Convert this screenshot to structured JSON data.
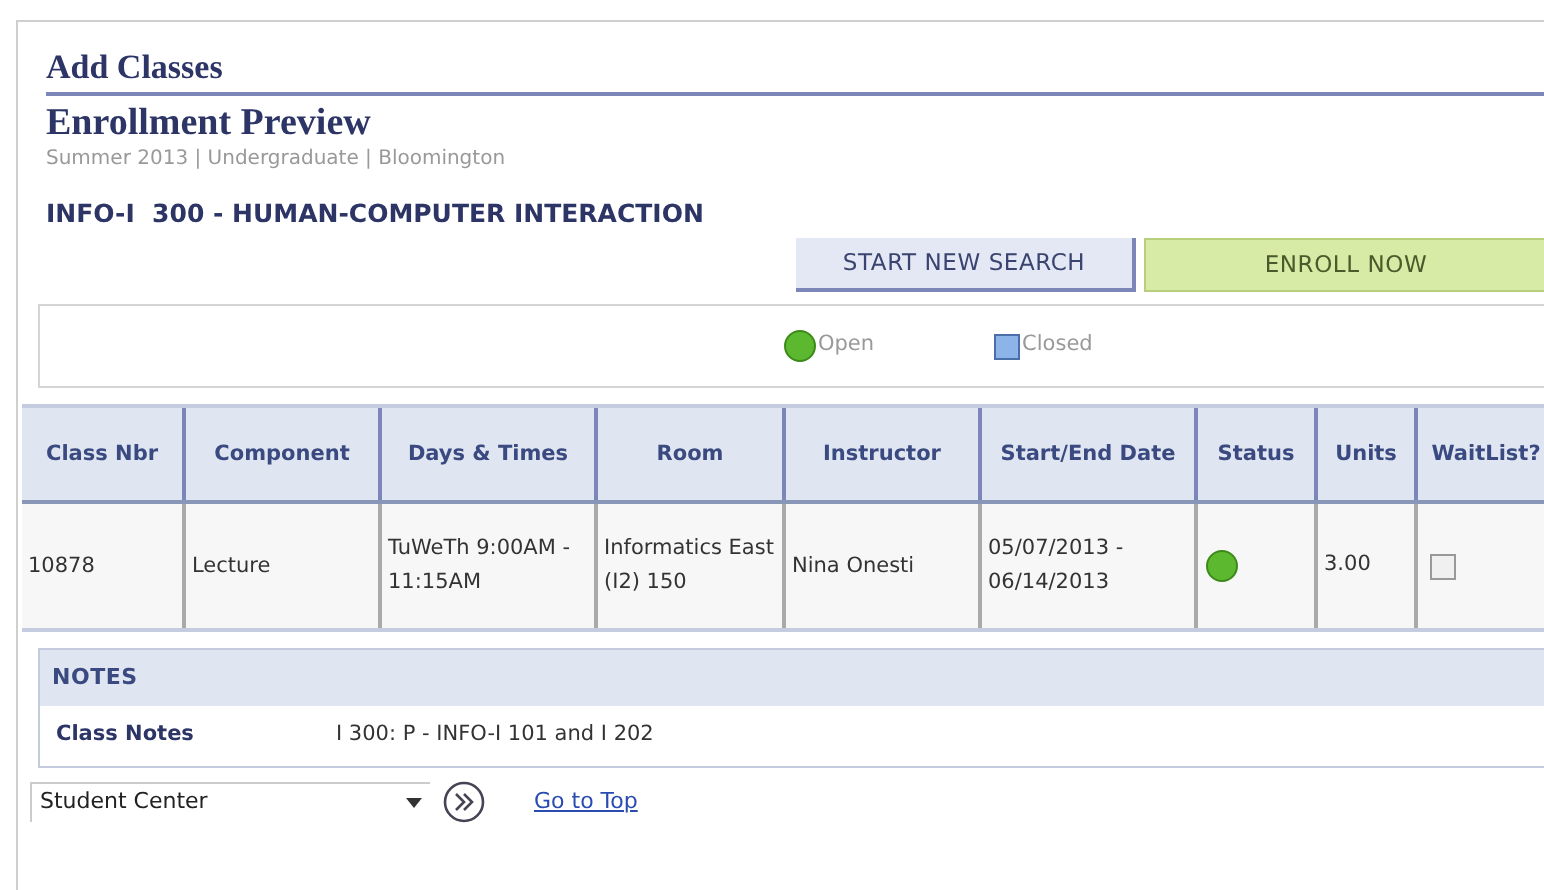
{
  "page_title": "Add Classes",
  "heading": "Enrollment Preview",
  "subtitle": "Summer 2013 | Undergraduate | Bloomington",
  "course_title": "INFO-I  300 - HUMAN-COMPUTER INTERACTION",
  "buttons": [
    {
      "label": "START NEW SEARCH",
      "kind": "secondary"
    },
    {
      "label": "ENROLL NOW",
      "kind": "primary"
    }
  ],
  "legend": [
    {
      "label": "Open",
      "kind": "open"
    },
    {
      "label": "Closed",
      "kind": "closed"
    }
  ],
  "table": {
    "columns": [
      "Class Nbr",
      "Component",
      "Days & Times",
      "Room",
      "Instructor",
      "Start/End Date",
      "Status",
      "Units",
      "WaitList?"
    ],
    "rows": [
      {
        "class_nbr": "10878",
        "component": "Lecture",
        "days_times": "TuWeTh 9:00AM - 11:15AM",
        "room": "Informatics East (I2) 150",
        "instructor": "Nina Onesti",
        "dates": "05/07/2013 - 06/14/2013",
        "kind": "open",
        "units": "3.00",
        "waitlist_checked": false
      }
    ]
  },
  "notes": {
    "title": "NOTES",
    "label": "Class Notes",
    "text": "I 300: P - INFO-I 101 and I 202"
  },
  "footer": {
    "dropdown_value": "Student Center",
    "link": "Go to Top"
  }
}
